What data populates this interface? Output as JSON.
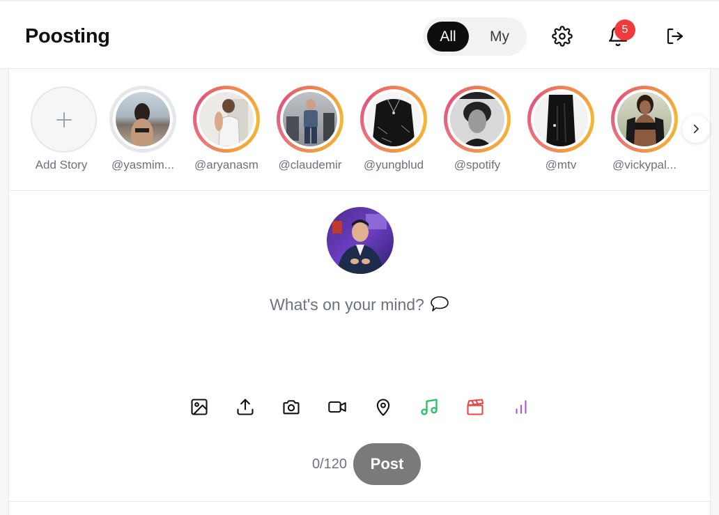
{
  "app": {
    "title": "Poosting"
  },
  "feed_toggle": {
    "options": [
      "All",
      "My"
    ],
    "selected": "All"
  },
  "header": {
    "icons": [
      "gear-icon",
      "bell-icon",
      "logout-icon"
    ],
    "notification_count": "5",
    "badge_color": "#ef3b3b"
  },
  "stories": {
    "add_label": "Add Story",
    "items": [
      {
        "handle": "@yasmim...",
        "seen": true
      },
      {
        "handle": "@aryanasm",
        "seen": false
      },
      {
        "handle": "@claudemir",
        "seen": false
      },
      {
        "handle": "@yungblud",
        "seen": false
      },
      {
        "handle": "@spotify",
        "seen": false
      },
      {
        "handle": "@mtv",
        "seen": false
      },
      {
        "handle": "@vickypal...",
        "seen": false
      }
    ],
    "next_icon": "chevron-right-icon"
  },
  "composer": {
    "placeholder": "What's on your mind?",
    "tools": [
      "image-icon",
      "upload-icon",
      "camera-icon",
      "video-icon",
      "location-pin-icon",
      "music-icon",
      "clapperboard-icon",
      "poll-icon"
    ],
    "tool_colors": {
      "music": "#22c55e",
      "clapperboard": "#ef4444",
      "poll": "#a855f7"
    },
    "char_count": "0/120",
    "post_label": "Post"
  }
}
